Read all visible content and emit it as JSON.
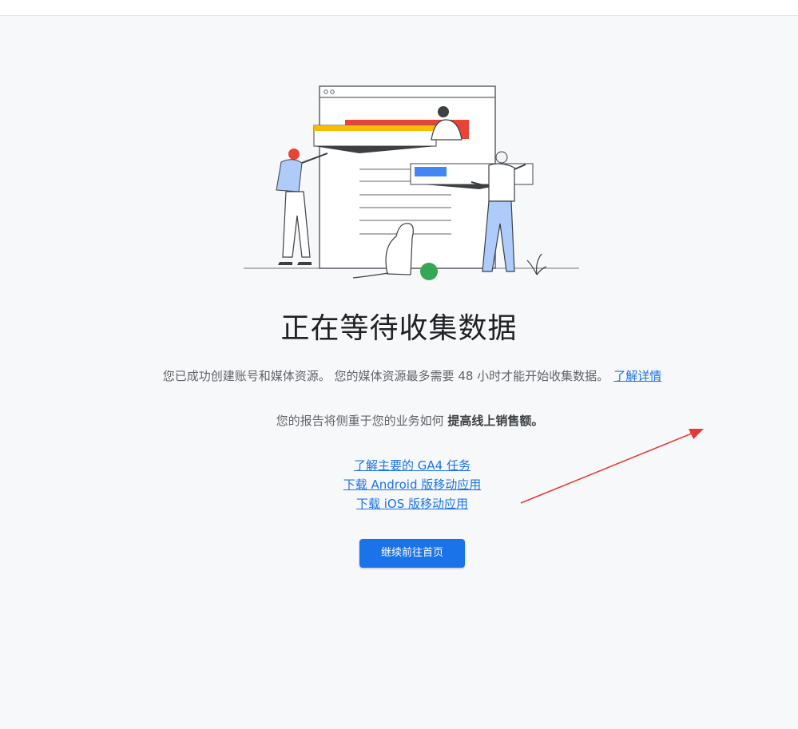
{
  "colors": {
    "accent": "#1a73e8",
    "page_background": "#f7f8fa",
    "annotation_arrow": "#e53935"
  },
  "main": {
    "title": "正在等待收集数据",
    "description": "您已成功创建账号和媒体资源。 您的媒体资源最多需要 48 小时才能开始收集数据。",
    "learn_more": "了解详情",
    "focus_prefix": "您的报告将侧重于您的业务如何 ",
    "focus_bold": "提高线上销售额。",
    "links": [
      "了解主要的 GA4 任务",
      "下载 Android 版移动应用",
      "下载 iOS 版移动应用"
    ],
    "continue_button": "继续前往首页"
  }
}
